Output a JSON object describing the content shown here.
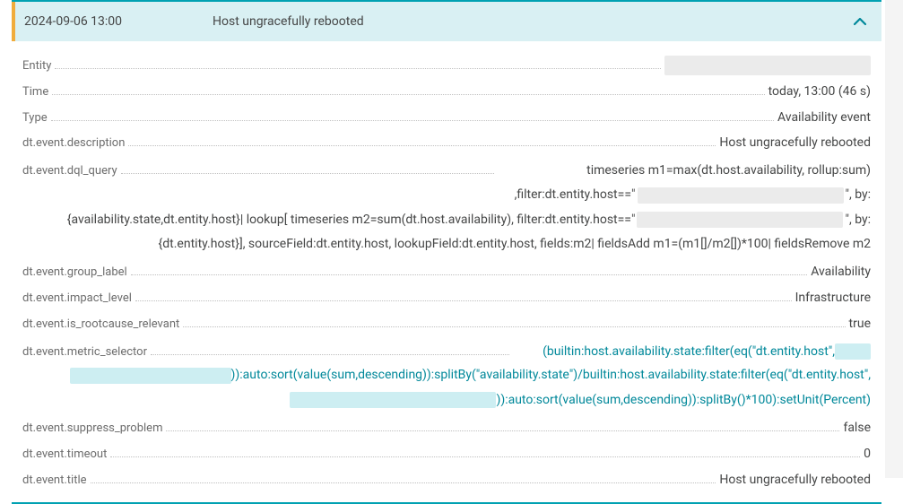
{
  "header": {
    "date": "2024-09-06 13:00",
    "title": "Host ungracefully rebooted"
  },
  "rows": {
    "entity": {
      "label": "Entity"
    },
    "time": {
      "label": "Time",
      "value": "today, 13:00 (46 s)"
    },
    "type": {
      "label": "Type",
      "value": "Availability event"
    },
    "description": {
      "label": "dt.event.description",
      "value": "Host ungracefully rebooted"
    },
    "group_label": {
      "label": "dt.event.group_label",
      "value": "Availability"
    },
    "impact_level": {
      "label": "dt.event.impact_level",
      "value": "Infrastructure"
    },
    "is_rootcause": {
      "label": "dt.event.is_rootcause_relevant",
      "value": "true"
    },
    "suppress": {
      "label": "dt.event.suppress_problem",
      "value": "false"
    },
    "timeout": {
      "label": "dt.event.timeout",
      "value": "0"
    },
    "title": {
      "label": "dt.event.title",
      "value": "Host ungracefully rebooted"
    }
  },
  "dql": {
    "label": "dt.event.dql_query",
    "part1": "timeseries m1=max(dt.host.availability, rollup:sum) ,filter:dt.entity.host==\"",
    "part1_tail": "\", by:",
    "part2": "{availability.state,dt.entity.host}| lookup[ timeseries m2=sum(dt.host.availability), filter:dt.entity.host==\"",
    "part2_tail": "\", by:",
    "part3": "{dt.entity.host}], sourceField:dt.entity.host, lookupField:dt.entity.host, fields:m2| fieldsAdd m1=(m1[]/m2[])*100| fieldsRemove m2"
  },
  "metric": {
    "label": "dt.event.metric_selector",
    "p1": "(builtin:host.availability.state:filter(eq(\"dt.entity.host\",",
    "p2_head": ")):auto:sort(value(sum,descending)):splitBy(\"availability.state\")/builtin:host.availability.state:filter(eq(\"dt.entity.host\",",
    "p3_tail": ")):auto:sort(value(sum,descending)):splitBy()*100):setUnit(Percent)"
  }
}
